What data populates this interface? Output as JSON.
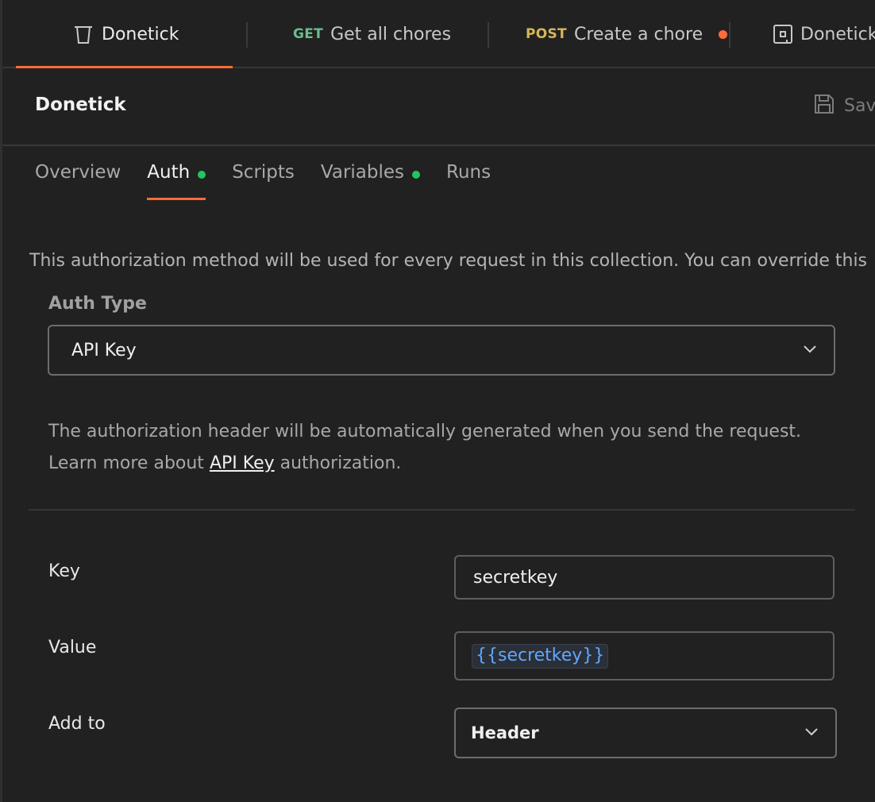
{
  "tabs": [
    {
      "label": "Donetick",
      "method": "",
      "icon": "collection-icon"
    },
    {
      "label": "Get all chores",
      "method": "GET"
    },
    {
      "label": "Create a chore",
      "method": "POST",
      "unsaved": true
    },
    {
      "label": "Donetick",
      "method": "",
      "icon": "environment-icon"
    }
  ],
  "collection": {
    "title": "Donetick",
    "save_label": "Save"
  },
  "subtabs": [
    {
      "label": "Overview",
      "dot": false
    },
    {
      "label": "Auth",
      "dot": true,
      "active": true
    },
    {
      "label": "Scripts",
      "dot": false
    },
    {
      "label": "Variables",
      "dot": true
    },
    {
      "label": "Runs",
      "dot": false
    }
  ],
  "auth": {
    "intro": "This authorization method will be used for every request in this collection. You can override this",
    "type_label": "Auth Type",
    "type_value": "API Key",
    "help_line1": "The authorization header will be automatically generated when you send the request.",
    "help_prefix": "Learn more about ",
    "help_link": "API Key",
    "help_suffix": " authorization.",
    "fields": {
      "key_label": "Key",
      "key_value": "secretkey",
      "value_label": "Value",
      "value_value": "{{secretkey}}",
      "addto_label": "Add to",
      "addto_value": "Header"
    }
  },
  "colors": {
    "accent": "#ff6c37",
    "status_green": "#22c55e",
    "get": "#6bbd8d",
    "post": "#d6b658",
    "variable": "#5fa7ff"
  }
}
